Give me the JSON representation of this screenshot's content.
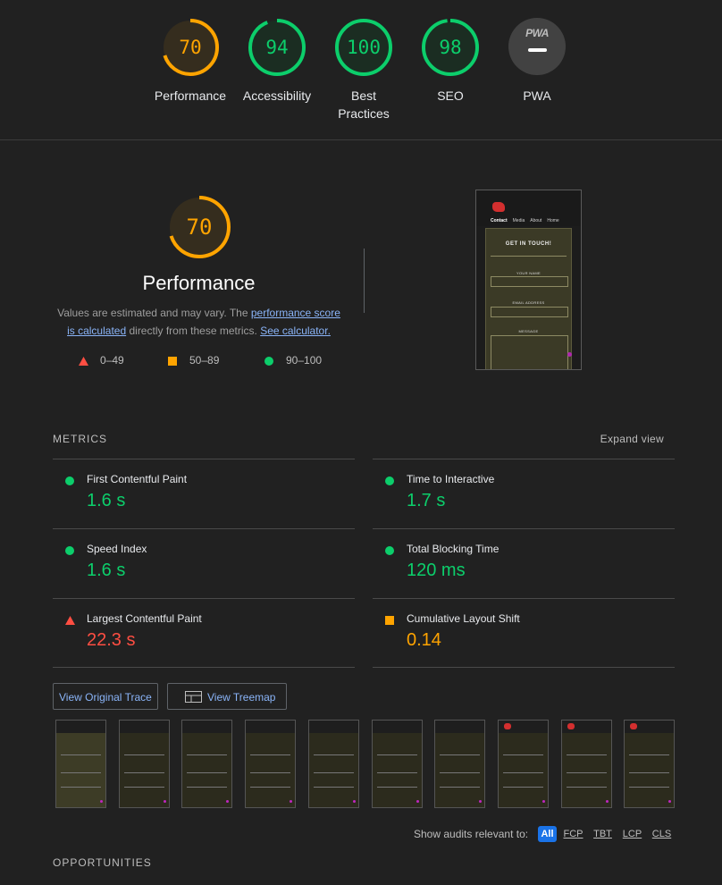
{
  "gauges": [
    {
      "label": "Performance",
      "score": "70",
      "fraction": 0.7,
      "color": "#ffa400"
    },
    {
      "label": "Accessibility",
      "score": "94",
      "fraction": 0.94,
      "color": "#0cce6b"
    },
    {
      "label": "Best Practices",
      "score": "100",
      "fraction": 1.0,
      "color": "#0cce6b"
    },
    {
      "label": "SEO",
      "score": "98",
      "fraction": 0.98,
      "color": "#0cce6b"
    },
    {
      "label": "PWA",
      "badge": "PWA"
    }
  ],
  "performance": {
    "score": "70",
    "fraction": 0.7,
    "title": "Performance",
    "desc_before": "Values are estimated and may vary. The ",
    "desc_link1": "performance score is calculated",
    "desc_middle": " directly from these metrics. ",
    "desc_link2": "See calculator.",
    "legend": [
      {
        "range": "0–49",
        "shape": "triangle",
        "color": "#ff4e42"
      },
      {
        "range": "50–89",
        "shape": "square",
        "color": "#ffa400"
      },
      {
        "range": "90–100",
        "shape": "circle",
        "color": "#0cce6b"
      }
    ]
  },
  "screenshot": {
    "nav_links": [
      "Contact",
      "Media",
      "About",
      "Home"
    ],
    "heading": "GET IN TOUCH!",
    "fields": [
      "YOUR NAME",
      "EMAIL ADDRESS",
      "MESSAGE"
    ]
  },
  "metrics": {
    "heading": "METRICS",
    "expand_label": "Expand view",
    "items": [
      {
        "name": "First Contentful Paint",
        "value": "1.6 s",
        "status": "pass",
        "color": "#0cce6b"
      },
      {
        "name": "Time to Interactive",
        "value": "1.7 s",
        "status": "pass",
        "color": "#0cce6b"
      },
      {
        "name": "Speed Index",
        "value": "1.6 s",
        "status": "pass",
        "color": "#0cce6b"
      },
      {
        "name": "Total Blocking Time",
        "value": "120 ms",
        "status": "pass",
        "color": "#0cce6b"
      },
      {
        "name": "Largest Contentful Paint",
        "value": "22.3 s",
        "status": "fail",
        "color": "#ff4e42"
      },
      {
        "name": "Cumulative Layout Shift",
        "value": "0.14",
        "status": "average",
        "color": "#ffa400"
      }
    ]
  },
  "buttons": {
    "trace_label": "View Original Trace",
    "treemap_label": "View Treemap"
  },
  "filmstrip": {
    "frames": 10,
    "nav_text": "Contact Media About Home",
    "heading": "GET IN TOUCH!"
  },
  "filter": {
    "label": "Show audits relevant to:",
    "chips": [
      "All",
      "FCP",
      "TBT",
      "LCP",
      "CLS"
    ],
    "active": "All"
  },
  "opportunities_heading": "OPPORTUNITIES"
}
